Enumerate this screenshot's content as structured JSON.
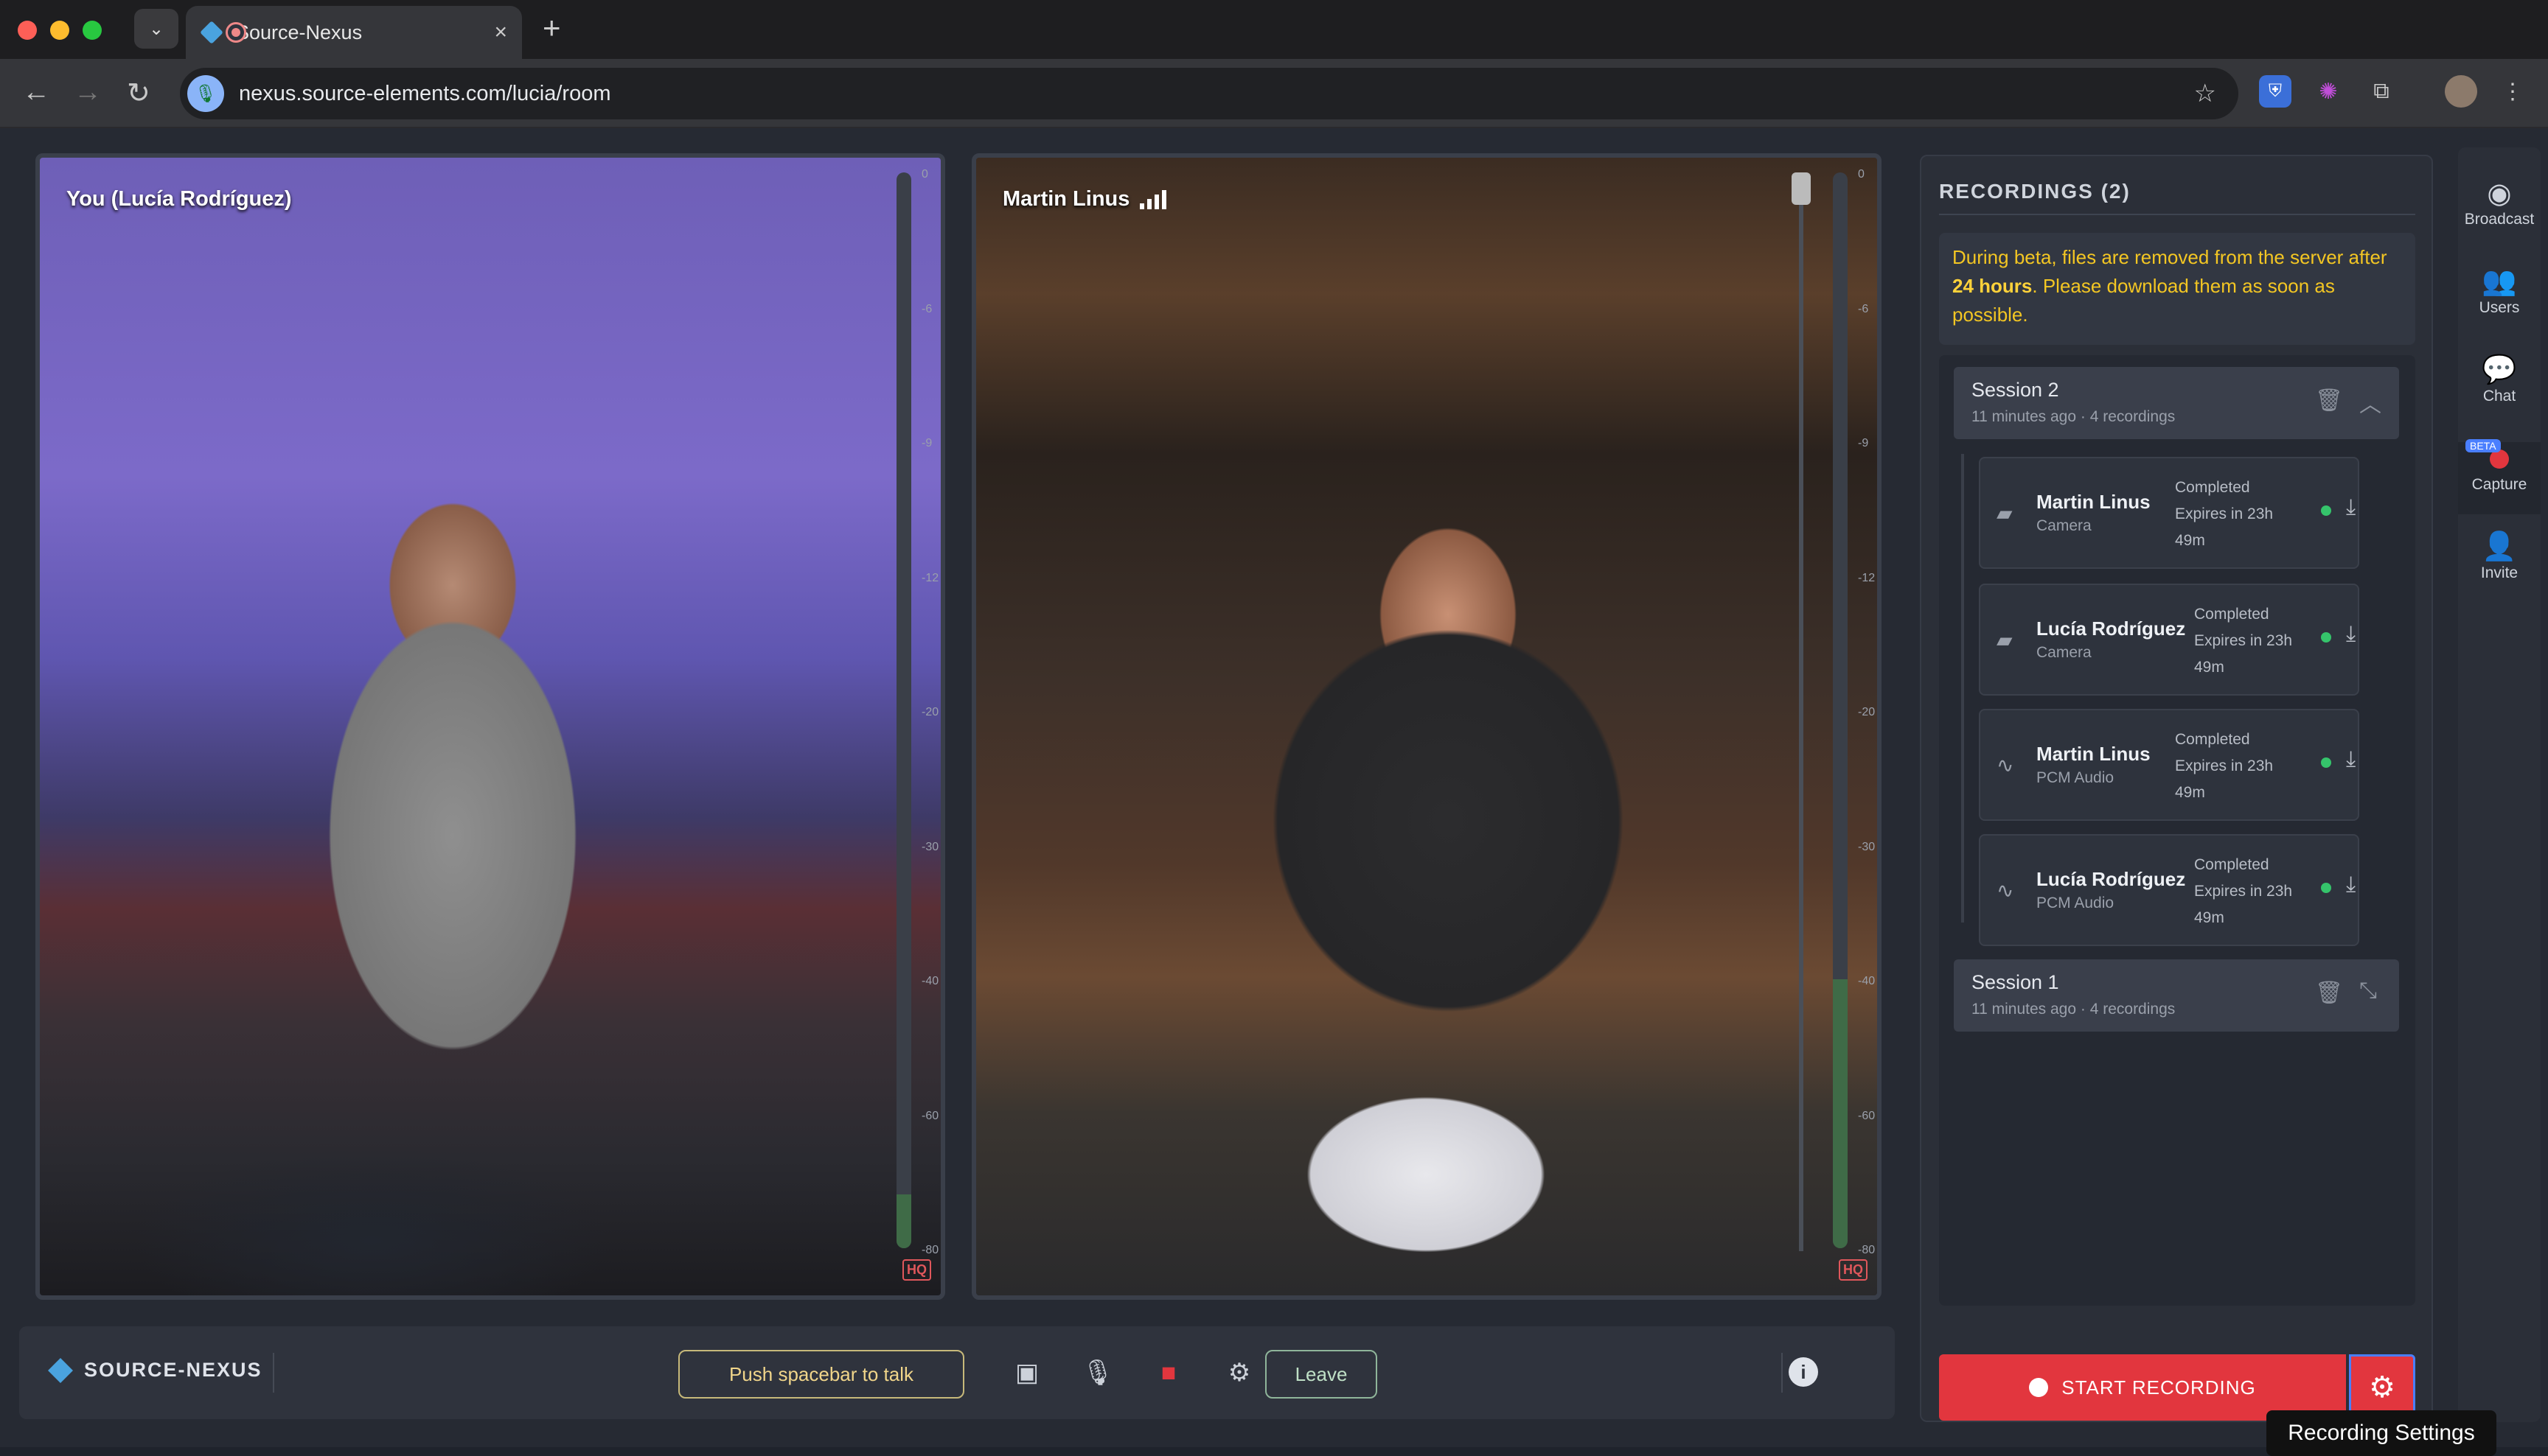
{
  "browser": {
    "tab_title": "Source-Nexus",
    "url": "nexus.source-elements.com/lucia/room",
    "tab_close": "×",
    "new_tab": "+"
  },
  "videos": {
    "local": {
      "label": "You (Lucía Rodríguez)",
      "badge": "HQ"
    },
    "remote": {
      "label": "Martin Linus",
      "badge": "HQ"
    },
    "meter_scale": [
      "0",
      "-6",
      "-9",
      "-12",
      "-20",
      "-30",
      "-40",
      "-60",
      "-80"
    ],
    "local_level": 0.05,
    "remote_level": 0.25
  },
  "bottom_bar": {
    "brand": "SOURCE-NEXUS",
    "push_to_talk": "Push spacebar to talk",
    "leave": "Leave",
    "info": "i"
  },
  "recordings": {
    "title": "RECORDINGS (2)",
    "notice_pre": "During beta, files are removed from the server after ",
    "notice_bold": "24 hours",
    "notice_post": ". Please download them as soon as possible.",
    "sessions": [
      {
        "name": "Session 2",
        "meta": "11 minutes ago · 4 recordings",
        "items": [
          {
            "name": "Martin Linus",
            "type": "Camera",
            "status": "Completed",
            "expires": "Expires in 23h",
            "expires2": "49m",
            "icon": "camera-icon"
          },
          {
            "name": "Lucía Rodríguez",
            "type": "Camera",
            "status": "Completed",
            "expires": "Expires in 23h",
            "expires2": "49m",
            "icon": "camera-icon"
          },
          {
            "name": "Martin Linus",
            "type": "PCM Audio",
            "status": "Completed",
            "expires": "Expires in 23h",
            "expires2": "49m",
            "icon": "waveform-icon"
          },
          {
            "name": "Lucía Rodríguez",
            "type": "PCM Audio",
            "status": "Completed",
            "expires": "Expires in 23h",
            "expires2": "49m",
            "icon": "waveform-icon"
          }
        ]
      },
      {
        "name": "Session 1",
        "meta": "11 minutes ago · 4 recordings"
      }
    ],
    "start_recording": "START RECORDING",
    "tooltip": "Recording Settings"
  },
  "sidebar": {
    "items": [
      {
        "label": "Broadcast"
      },
      {
        "label": "Users"
      },
      {
        "label": "Chat"
      },
      {
        "label": "Capture",
        "badge": "BETA"
      },
      {
        "label": "Invite"
      }
    ]
  },
  "colors": {
    "accent_red": "#e2363e",
    "brand_blue": "#4aa3df",
    "notice_yellow": "#f3c623"
  }
}
